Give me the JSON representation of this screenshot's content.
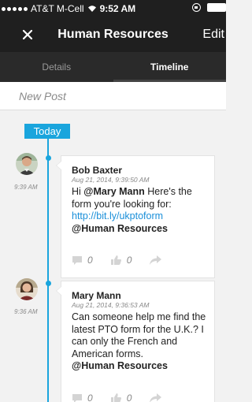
{
  "status_bar": {
    "carrier": "AT&T M-Cell",
    "time": "9:52 AM"
  },
  "nav": {
    "title": "Human Resources",
    "edit_label": "Edit"
  },
  "tabs": [
    {
      "label": "Details",
      "active": false
    },
    {
      "label": "Timeline",
      "active": true
    }
  ],
  "new_post": {
    "placeholder": "New Post"
  },
  "timeline": {
    "date_label": "Today",
    "posts": [
      {
        "author": "Bob Baxter",
        "timestamp": "Aug 21, 2014, 9:39:50 AM",
        "side_time": "9:39 AM",
        "body_prefix": "Hi ",
        "mention": "@Mary Mann",
        "body_rest": " Here's the form you're looking for:",
        "link": "http://bit.ly/ukptoform",
        "group_mention": "@Human Resources",
        "comments": "0",
        "likes": "0"
      },
      {
        "author": "Mary Mann",
        "timestamp": "Aug 21, 2014, 9:36:53 AM",
        "side_time": "9:36 AM",
        "body": "Can someone help me find the latest PTO form for the U.K.? I can only the French and American forms.",
        "group_mention": "@Human Resources",
        "comments": "0",
        "likes": "0"
      }
    ]
  },
  "colors": {
    "accent": "#1aa5dd",
    "bar": "#1f1f1f",
    "link": "#1a8fd9"
  }
}
